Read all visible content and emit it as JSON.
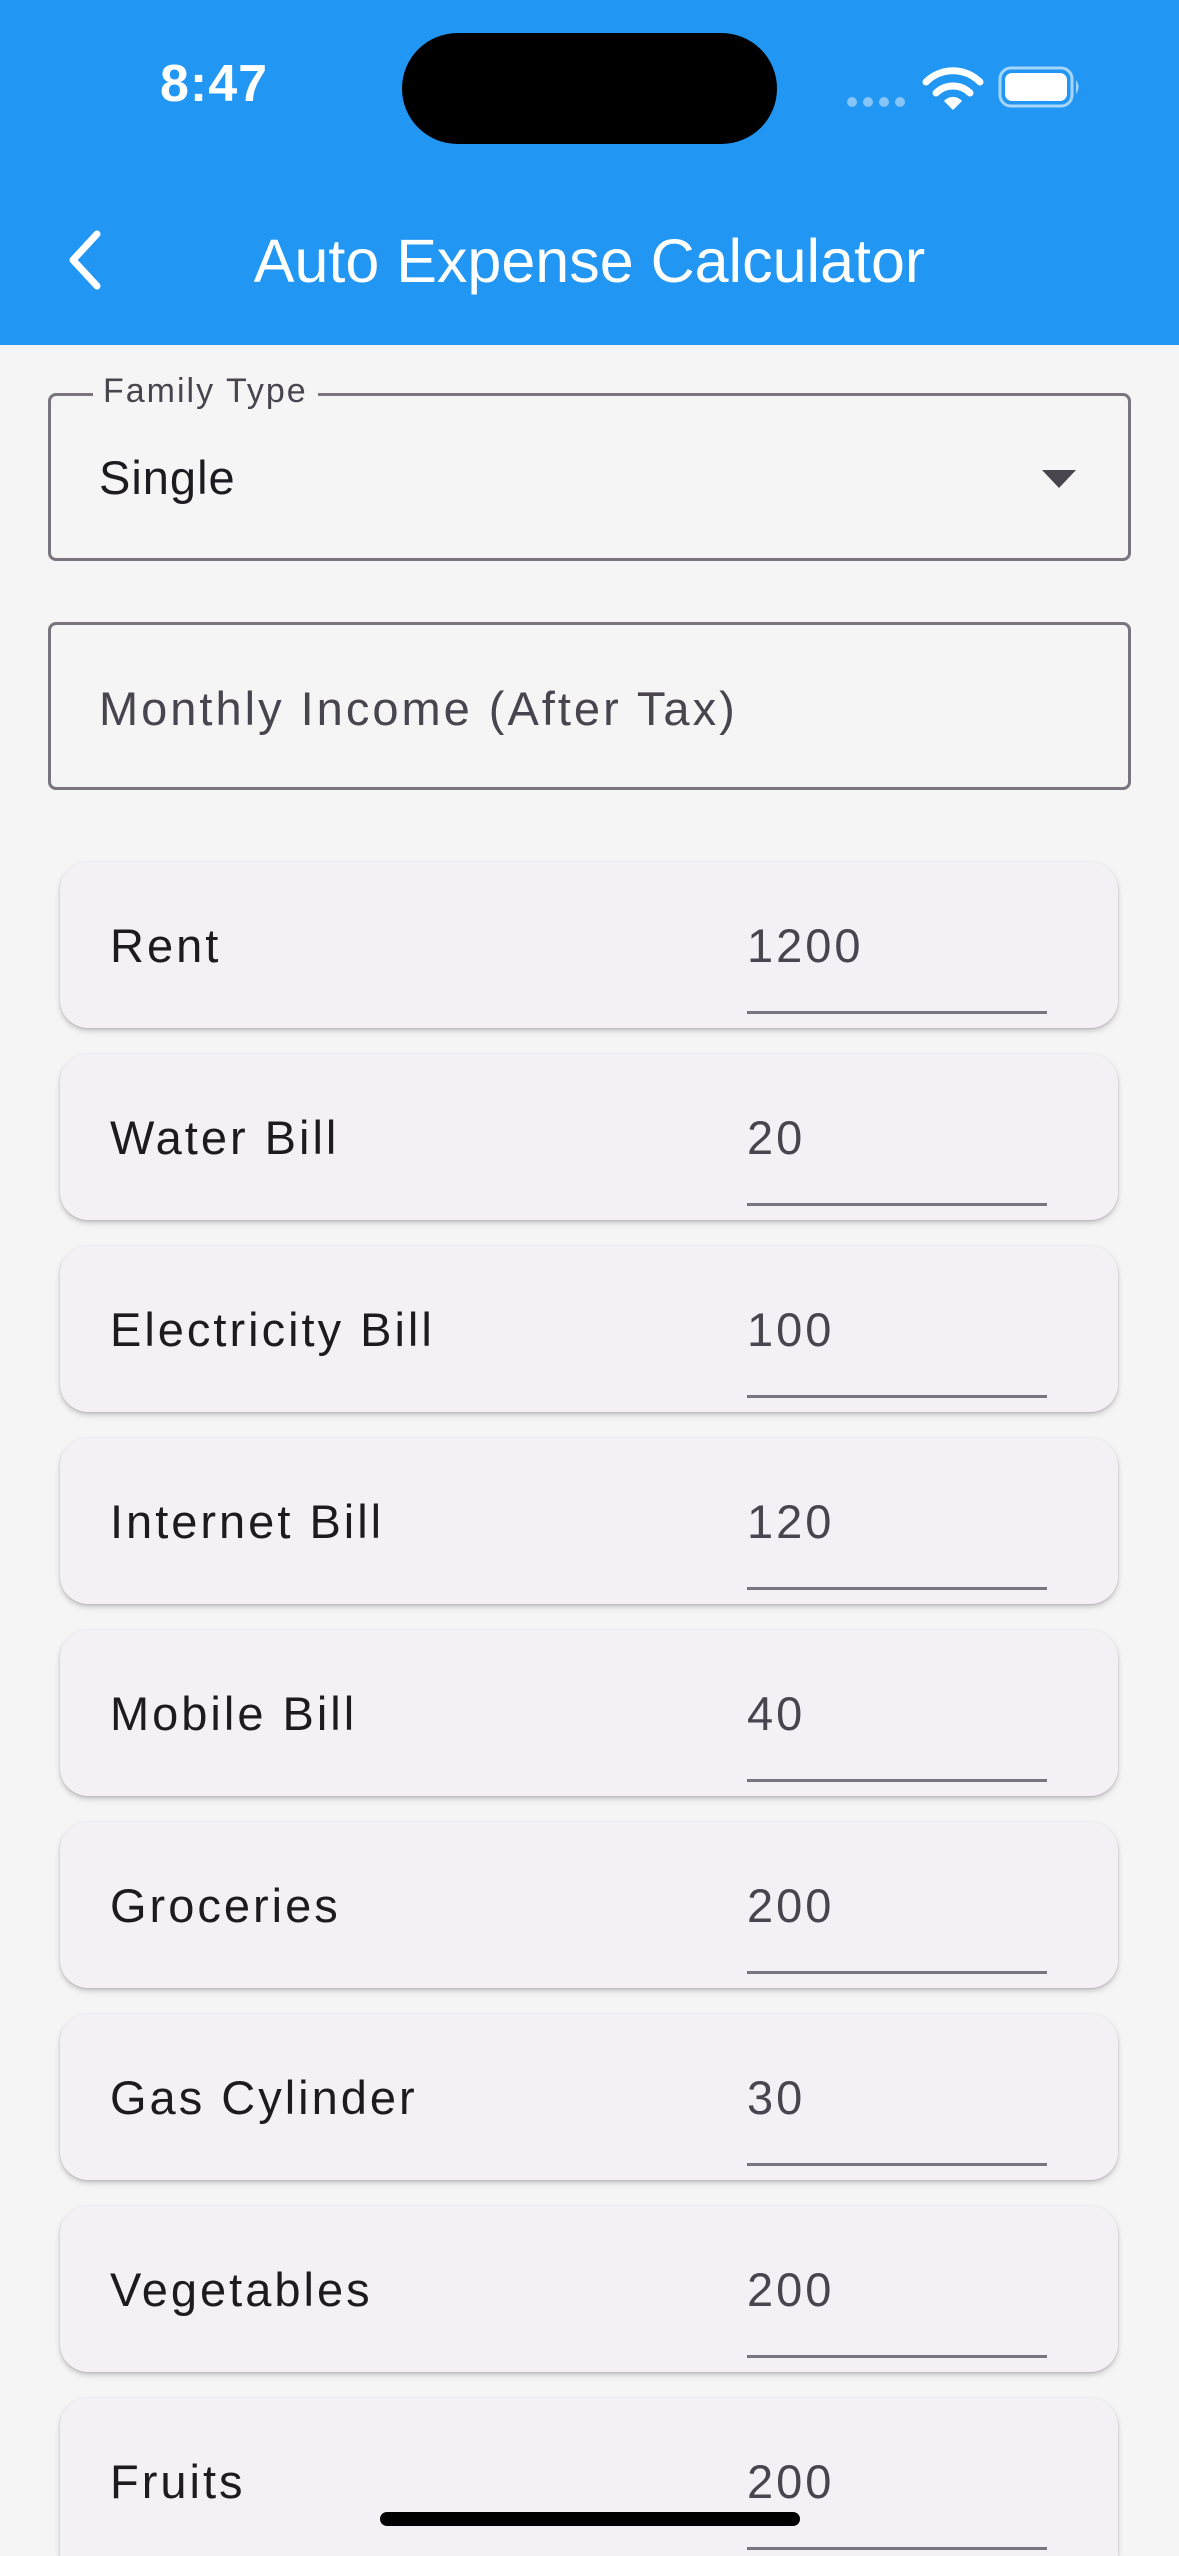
{
  "status_bar": {
    "time": "8:47"
  },
  "app_bar": {
    "title": "Auto Expense Calculator"
  },
  "family_type": {
    "label": "Family Type",
    "value": "Single"
  },
  "income": {
    "placeholder": "Monthly Income (After Tax)"
  },
  "expenses": [
    {
      "name": "Rent",
      "value": "1200"
    },
    {
      "name": "Water Bill",
      "value": "20"
    },
    {
      "name": "Electricity Bill",
      "value": "100"
    },
    {
      "name": "Internet Bill",
      "value": "120"
    },
    {
      "name": "Mobile Bill",
      "value": "40"
    },
    {
      "name": "Groceries",
      "value": "200"
    },
    {
      "name": "Gas Cylinder",
      "value": "30"
    },
    {
      "name": "Vegetables",
      "value": "200"
    },
    {
      "name": "Fruits",
      "value": "200"
    }
  ],
  "colors": {
    "app_bar": "#2196f3",
    "card": "#f4f1f6",
    "background": "#f5f5f5"
  },
  "icons": {
    "back": "chevron-left-icon",
    "dropdown": "caret-down-icon",
    "wifi": "wifi-icon",
    "battery": "battery-icon",
    "signal": "signal-icon"
  }
}
